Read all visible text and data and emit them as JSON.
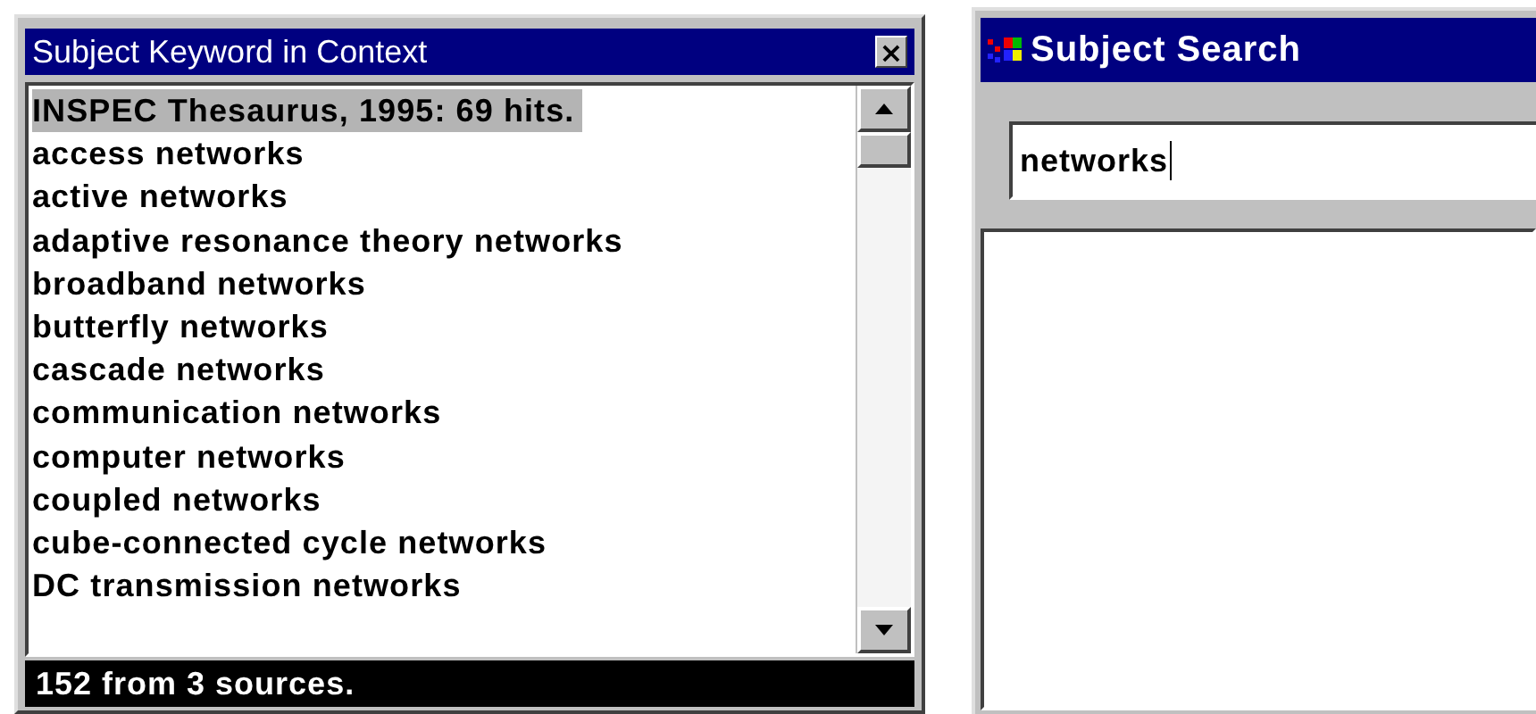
{
  "kwic_window": {
    "title": "Subject Keyword in Context",
    "close": "×",
    "rows": [
      {
        "text": "INSPEC Thesaurus, 1995: 69 hits.",
        "selected": true
      },
      {
        "text": "access networks",
        "selected": false
      },
      {
        "text": "active networks",
        "selected": false
      },
      {
        "text": "adaptive resonance theory networks",
        "selected": false
      },
      {
        "text": "broadband networks",
        "selected": false
      },
      {
        "text": "butterfly networks",
        "selected": false
      },
      {
        "text": "cascade networks",
        "selected": false
      },
      {
        "text": "communication networks",
        "selected": false
      },
      {
        "text": "computer networks",
        "selected": false
      },
      {
        "text": "coupled networks",
        "selected": false
      },
      {
        "text": "cube-connected cycle networks",
        "selected": false
      },
      {
        "text": "DC transmission networks",
        "selected": false
      }
    ],
    "status": "152 from 3 sources."
  },
  "search_window": {
    "title": "Subject Search",
    "query": "networks"
  }
}
